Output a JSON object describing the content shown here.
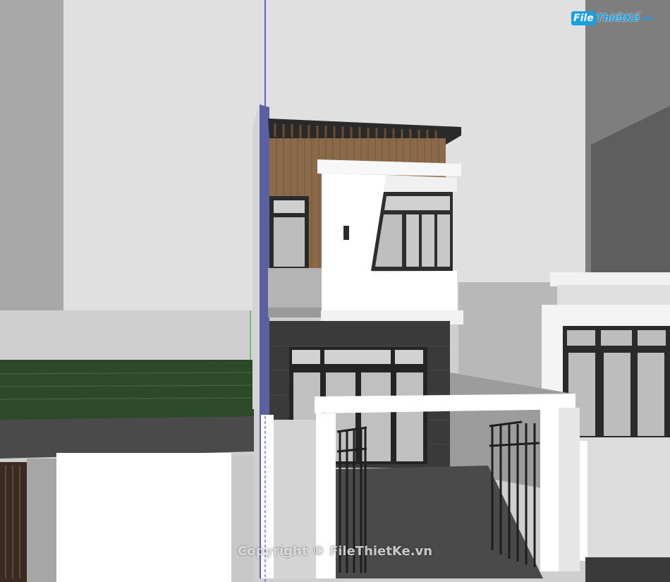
{
  "logo": {
    "file": "File",
    "rest": "ThiếtKế",
    "tld": ".vn"
  },
  "watermark": "Copyright © FileThietKe.vn",
  "colors": {
    "sky": "#d8d8d8",
    "wood": "#8a6a4a",
    "white_wall": "#f4f4f4",
    "dark_tile": "#3a3a3a",
    "pavement": "#4a4a4a",
    "hedge": "#2e4a2a",
    "axis_blue": "#2a3ad0"
  }
}
